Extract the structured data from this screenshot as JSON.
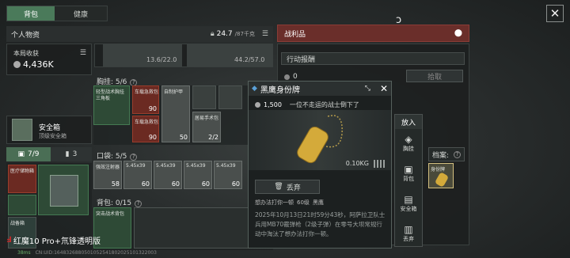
{
  "tabs": {
    "backpack": "背包",
    "health": "健康"
  },
  "personal": {
    "title": "个人物资",
    "weight": "24.7",
    "weight_max": "/87千克",
    "local_income_label": "本局收获",
    "local_income_value": "4,436K",
    "gear_weight_a": "13.6/22.0",
    "gear_weight_b": "44.2/57.0"
  },
  "safebox": {
    "title": "安全箱",
    "subtitle": "顶级安全箱"
  },
  "counters": {
    "items": "7/9",
    "ammo": "3"
  },
  "chest": {
    "label": "胸挂: 5/6",
    "items": [
      {
        "name": "轻型战术胸挂",
        "sub": "三角板",
        "count": ""
      },
      {
        "name": "车载急救包",
        "count": "90"
      },
      {
        "name": "自制护甲",
        "count": "50"
      },
      {
        "name": "居易手术包",
        "count": "2/2"
      },
      {
        "name": "车载急救包",
        "count": "90"
      }
    ]
  },
  "pocket": {
    "label": "口袋: 5/5",
    "items": [
      {
        "name": "强效注射器",
        "count": "58"
      },
      {
        "name": "5.45x39",
        "count": "60"
      },
      {
        "name": "5.45x39",
        "count": "60"
      },
      {
        "name": "5.45x39",
        "count": "60"
      },
      {
        "name": "5.45x39",
        "count": "60"
      }
    ]
  },
  "backpack": {
    "label": "背包: 0/15",
    "item_name": "突击战术背包"
  },
  "left_items": {
    "case_name": "医疗储物箱",
    "b2_name": "战备箱"
  },
  "loot": {
    "title": "战利品",
    "action_label": "行动报酬",
    "money": "0",
    "pickup": "拾取"
  },
  "detail": {
    "name": "黑鹰身份牌",
    "price": "1,500",
    "flavor": "一位不走运的战士倒下了",
    "weight": "0.10KG",
    "discard": "丢弃",
    "owner_prefix": "想办法打你一顿",
    "owner_level": "60级",
    "owner_faction": "黑鹰",
    "desc": "2025年10月13日21时59分43秒，阿萨拉卫队士兵用MB70霰弹枪（2级子弹）在零号大坝常规行动中淘汰了想办法打你一顿。"
  },
  "put_in": {
    "title": "放入",
    "options": [
      "胸挂",
      "背包",
      "安全箱",
      "丢弃"
    ]
  },
  "archive": {
    "label": "档案:",
    "item": "身份牌"
  },
  "footer": {
    "watermark": "红魔10 Pro+氘锋透明版",
    "ping": "38ms",
    "uid": "CN:UID:1648326880501052541802025101322003"
  }
}
